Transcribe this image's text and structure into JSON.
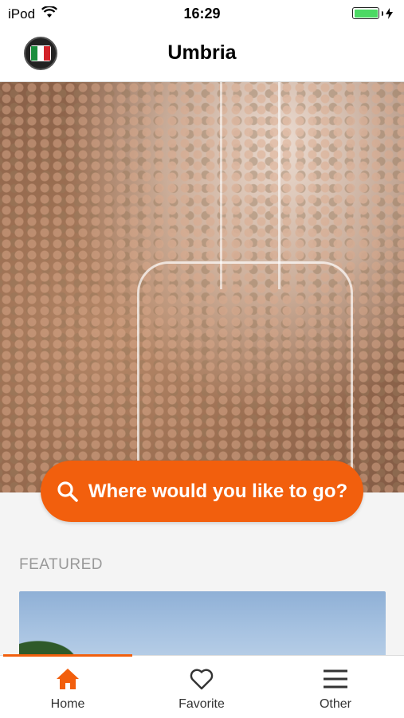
{
  "status_bar": {
    "carrier": "iPod",
    "time": "16:29",
    "battery_level": 1.0,
    "battery_color": "#4cd964"
  },
  "header": {
    "title": "Umbria",
    "logo_icon": "italy-flag-logo-icon"
  },
  "hero": {
    "image_subject": "lentils",
    "search_label": "Where would you like to go?",
    "search_icon": "search-icon",
    "accent_color": "#f25f0d"
  },
  "featured": {
    "heading": "FEATURED"
  },
  "tab_bar": {
    "active_tab": "home",
    "tabs": [
      {
        "id": "home",
        "label": "Home",
        "icon": "home-icon"
      },
      {
        "id": "favorite",
        "label": "Favorite",
        "icon": "heart-icon"
      },
      {
        "id": "other",
        "label": "Other",
        "icon": "menu-icon"
      }
    ]
  }
}
